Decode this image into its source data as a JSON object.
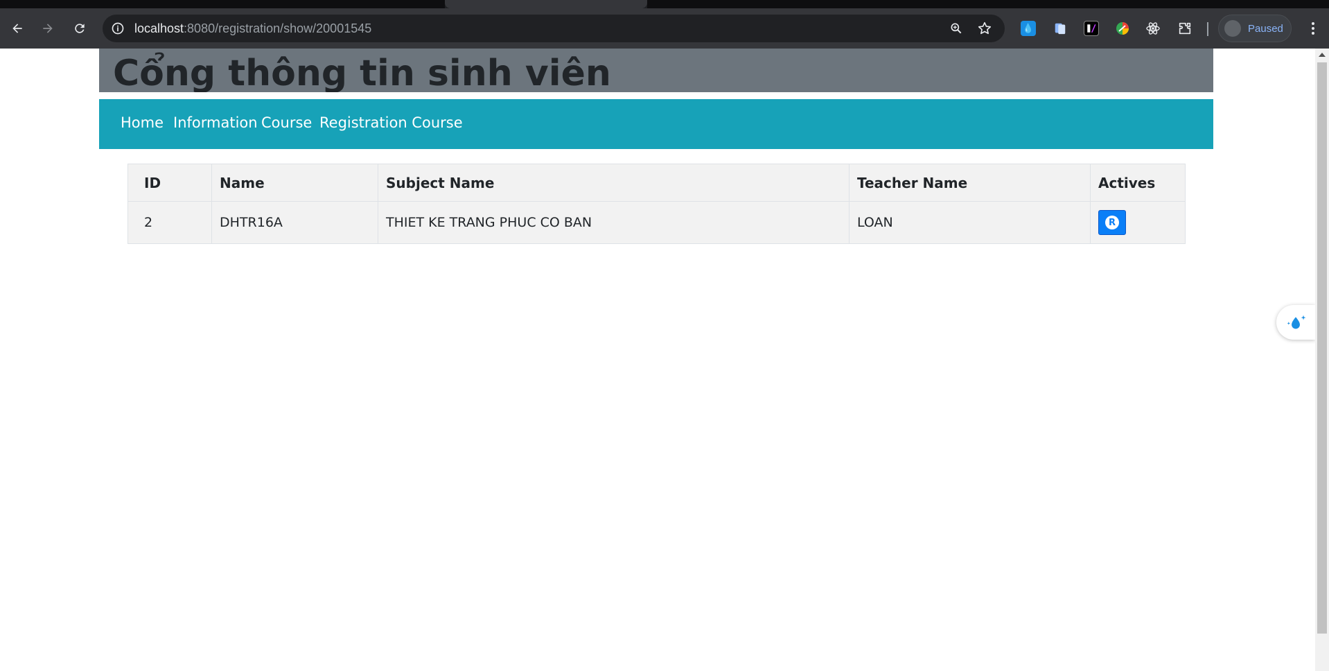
{
  "browser": {
    "url_host": "localhost",
    "url_rest": ":8080/registration/show/20001545",
    "profile_label": "Paused"
  },
  "page": {
    "title": "Cổng thông tin sinh viên",
    "nav": [
      "Home",
      "Information",
      "Course",
      "Registration Course"
    ]
  },
  "table": {
    "headers": [
      "ID",
      "Name",
      "Subject Name",
      "Teacher Name",
      "Actives"
    ],
    "rows": [
      {
        "id": "2",
        "name": "DHTR16A",
        "subject": "THIET KE TRANG PHUC CO BAN",
        "teacher": "LOAN",
        "action": "R"
      }
    ]
  },
  "icons": {
    "back": "arrow-left-icon",
    "forward": "arrow-right-icon",
    "reload": "reload-icon",
    "site_info": "info-icon",
    "zoom": "zoom-icon",
    "bookmark": "star-icon",
    "extensions": "puzzle-icon",
    "menu": "kebab-menu-icon",
    "widget": "droplet-sparkle-icon"
  },
  "colors": {
    "banner": "#6c757d",
    "navbar": "#17a2b8",
    "action_button": "#0a7ff7",
    "table_bg": "#f2f2f2"
  }
}
